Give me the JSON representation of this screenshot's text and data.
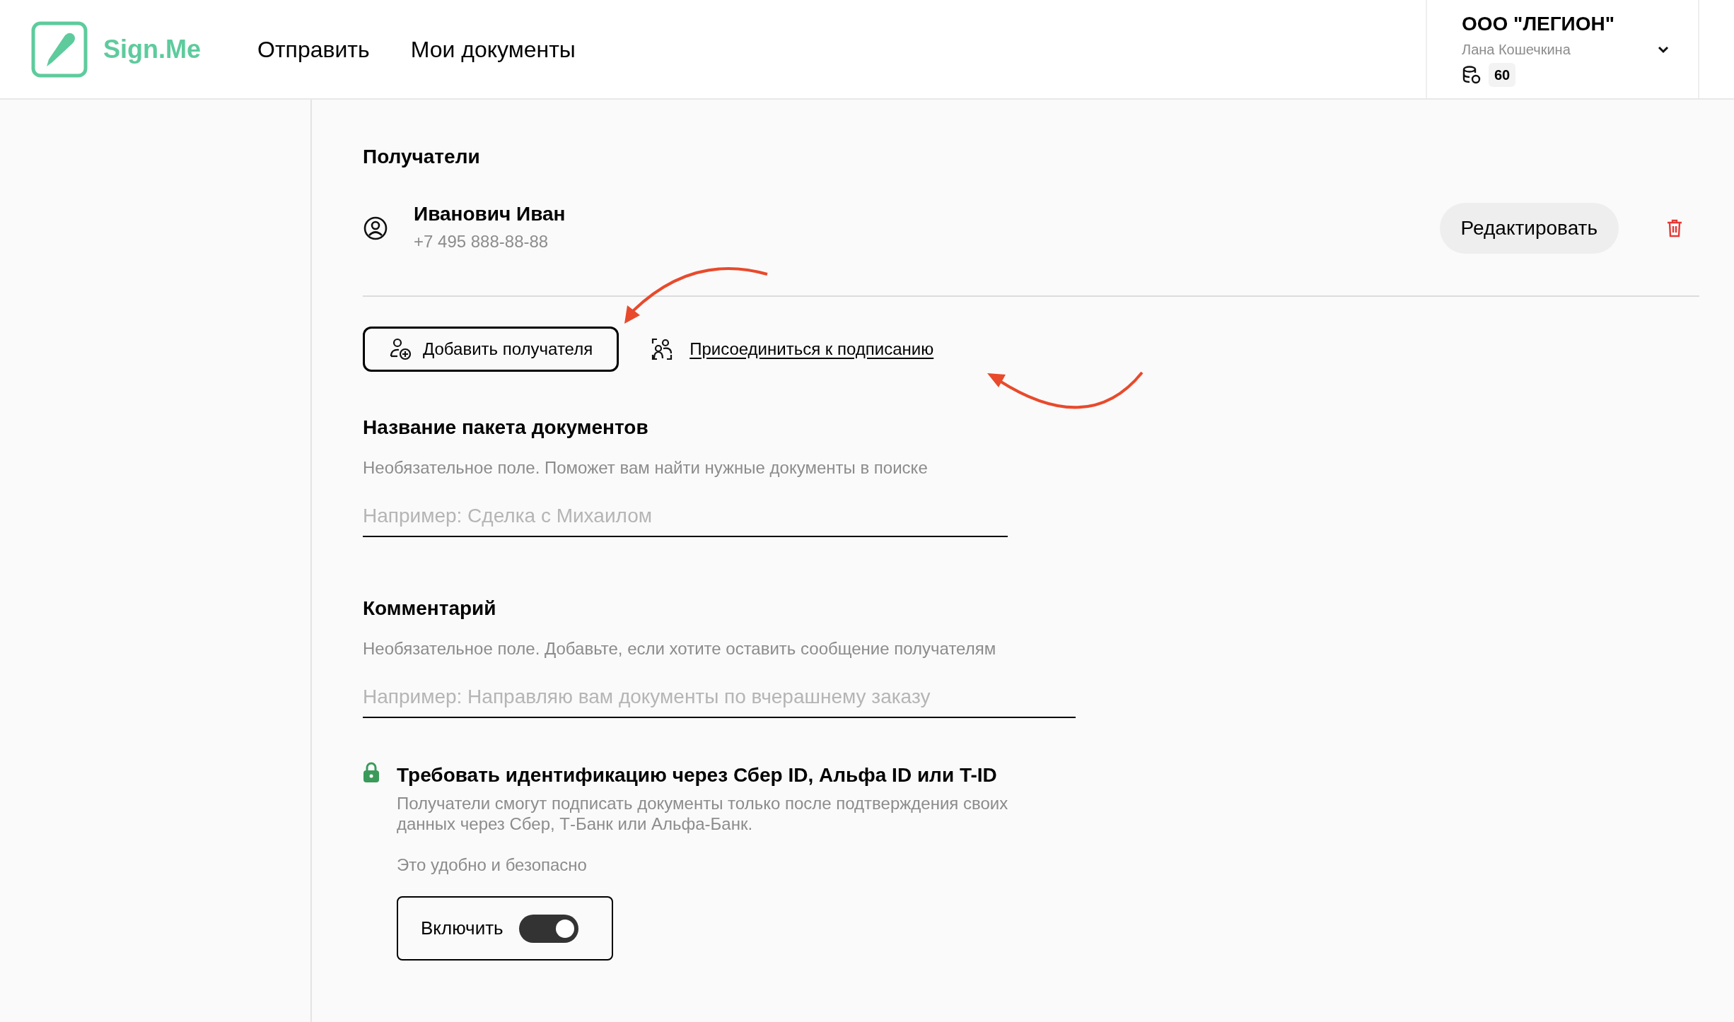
{
  "header": {
    "logo": "Sign.Me",
    "nav": [
      {
        "label": "Отправить"
      },
      {
        "label": "Мои документы"
      }
    ],
    "account": {
      "company": "ООО \"ЛЕГИОН\"",
      "user": "Лана Кошечкина",
      "balance": "60"
    }
  },
  "recipients": {
    "title": "Получатели",
    "items": [
      {
        "name": "Иванович Иван",
        "phone": "+7 495 888-88-88",
        "edit_button": "Редактировать"
      }
    ],
    "add_button": "Добавить получателя",
    "join_link": "Присоединиться к подписанию"
  },
  "fields": [
    {
      "title": "Название пакета документов",
      "hint": "Необязательное поле. Поможет вам найти нужные документы в поиске",
      "placeholder": "Например: Сделка с Михаилом"
    },
    {
      "title": "Комментарий",
      "hint": "Необязательное поле. Добавьте, если хотите оставить сообщение получателям",
      "placeholder": "Например: Направляю вам документы по вчерашнему заказу"
    }
  ],
  "identification": {
    "title": "Требовать идентификацию через Сбер ID, Альфа ID или T-ID",
    "description": "Получатели смогут подписать документы только после подтверждения своих данных через Сбер, Т-Банк или Альфа-Банк.",
    "note": "Это удобно и безопасно",
    "toggle": {
      "label": "Включить",
      "on": true
    }
  }
}
